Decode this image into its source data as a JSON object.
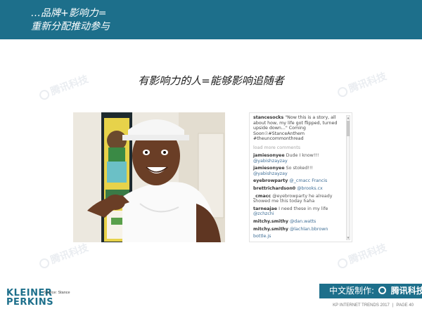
{
  "header": {
    "line1": "…品牌+影响力=",
    "line2": "重新分配推动参与"
  },
  "watermark": {
    "text": "腾讯科技"
  },
  "slide": {
    "heading": "有影响力的人=能够影响追随者"
  },
  "instagram": {
    "caption_user": "stancesocks",
    "caption_text": "\"Now this is a story, all about how, my life got flipped, turned upside down...\" Coming Soon☉#StanceAnthem #theuncommonthread",
    "load_more": "load more comments",
    "comments": [
      {
        "user": "jamiesonyee",
        "text": "Dude I know!!! ",
        "tag": "@yabishzayzay"
      },
      {
        "user": "jamiesonyee",
        "text": "So stoked!!! ",
        "tag": "@yabishzayzay"
      },
      {
        "user": "eyebrowparty",
        "text": "",
        "tag": "@_cmacc Francis"
      },
      {
        "user": "brettrichardson0",
        "text": "",
        "tag": "@brooks.cx"
      },
      {
        "user": "_cmacc",
        "text": "@eyebrowparty he already showed me this today haha",
        "tag": ""
      },
      {
        "user": "tarneajae",
        "text": "I need these in my life ",
        "tag": "@zchzchi"
      },
      {
        "user": "mitchy.smithy",
        "text": "",
        "tag": "@dan.watts"
      },
      {
        "user": "mitchy.smithy",
        "text": "",
        "tag": "@lachlan.bbrown"
      },
      {
        "user": "",
        "text": "",
        "tag": "bottle.js"
      }
    ]
  },
  "footer": {
    "logo_line1": "KLEINER",
    "logo_line2": "PERKINS",
    "source": "Source: Stance",
    "badge_prefix": "中文版制作:",
    "badge_brand": "腾讯科技",
    "report": "KP INTERNET TRENDS 2017",
    "separator": "|",
    "page": "PAGE 40"
  },
  "colors": {
    "brand": "#1d6f8b",
    "tag": "#3d6d95"
  }
}
